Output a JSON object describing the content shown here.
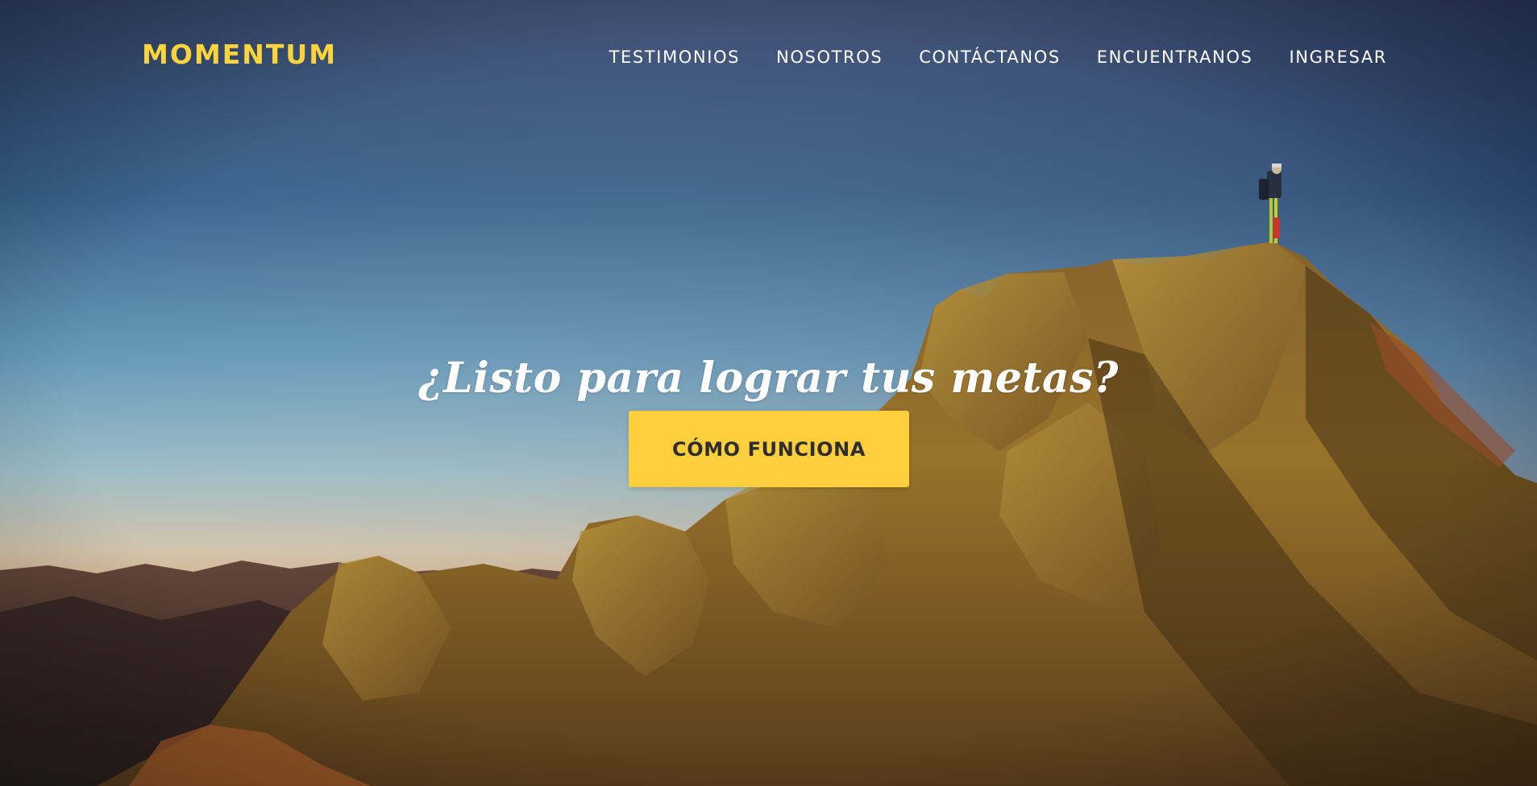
{
  "brand": {
    "name": "MOMENTUM",
    "color": "#fdd43c"
  },
  "nav": {
    "items": [
      {
        "label": "TESTIMONIOS"
      },
      {
        "label": "NOSOTROS"
      },
      {
        "label": "CONTÁCTANOS"
      },
      {
        "label": "ENCUENTRANOS"
      },
      {
        "label": "INGRESAR"
      }
    ]
  },
  "hero": {
    "title": "¿Listo para lograr tus metas?",
    "cta_label": "CÓMO FUNCIONA",
    "cta_color": "#fecf3c",
    "background": "mountain-peak-hiker-photo"
  }
}
